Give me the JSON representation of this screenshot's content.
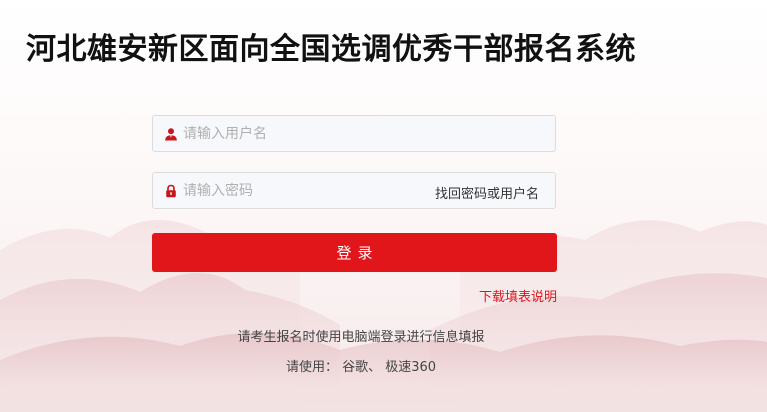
{
  "header": {
    "title": "河北雄安新区面向全国选调优秀干部报名系统"
  },
  "login": {
    "username_placeholder": "请输入用户名",
    "password_placeholder": "请输入密码",
    "recover_link": "找回密码或用户名",
    "submit_label": "登录",
    "download_link": "下载填表说明"
  },
  "notice": {
    "line1": "请考生报名时使用电脑端登录进行信息填报",
    "line2": "请使用： 谷歌、 极速360"
  },
  "icons": {
    "user": "user-icon",
    "lock": "lock-icon"
  },
  "colors": {
    "accent": "#e0161a",
    "link_red": "#d9171d",
    "icon_red": "#c8161d"
  }
}
